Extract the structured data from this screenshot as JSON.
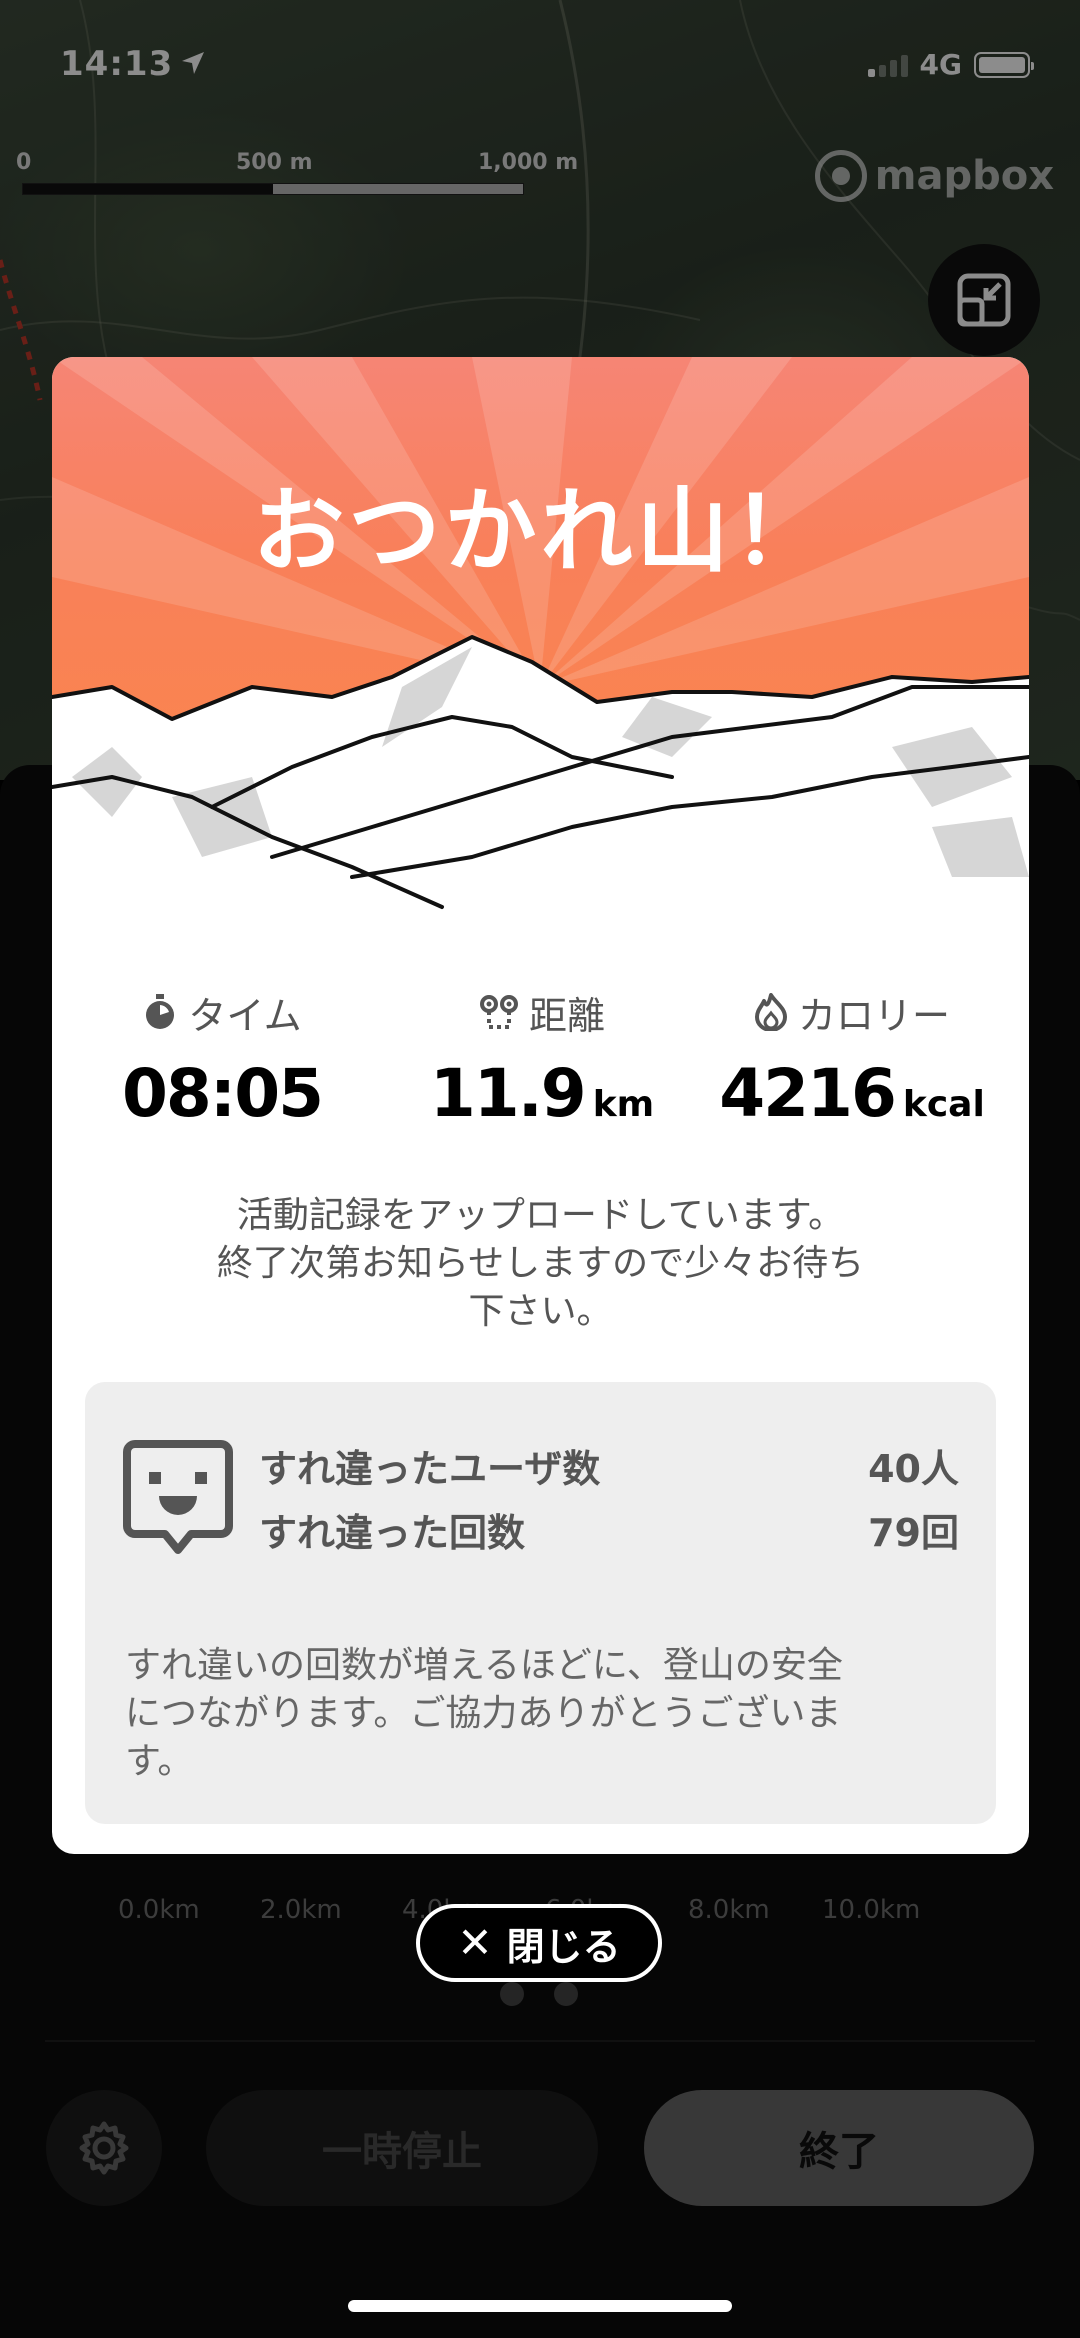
{
  "status_bar": {
    "time": "14:13",
    "network": "4G"
  },
  "map": {
    "scale_labels": [
      "0",
      "500 m",
      "1,000 m"
    ],
    "attribution": "mapbox",
    "route_marker": "00"
  },
  "modal": {
    "title": "おつかれ山！",
    "stats": {
      "time": {
        "label": "タイム",
        "value": "08:05",
        "unit": ""
      },
      "distance": {
        "label": "距離",
        "value": "11.9",
        "unit": "km"
      },
      "calories": {
        "label": "カロリー",
        "value": "4216",
        "unit": "kcal"
      }
    },
    "upload_message": {
      "line1": "活動記録をアップロードしています。",
      "line2": "終了次第お知らせしますので少々お待ち",
      "line3": "下さい。"
    },
    "encounter": {
      "users_label": "すれ違ったユーザ数",
      "users_value": "40人",
      "count_label": "すれ違った回数",
      "count_value": "79回",
      "note_line1": "すれ違いの回数が増えるほどに、登山の安全",
      "note_line2": "につながります。ご協力ありがとうございま",
      "note_line3": "す。"
    },
    "close_label": "閉じる"
  },
  "elevation_axis": [
    "0.0km",
    "2.0km",
    "4.0km",
    "6.0km",
    "8.0km",
    "10.0km"
  ],
  "controls": {
    "pause_label": "一時停止",
    "end_label": "終了"
  },
  "colors": {
    "header_top": "#f68575",
    "header_bottom": "#fa8846",
    "encounter_bg": "#eeeeee"
  }
}
